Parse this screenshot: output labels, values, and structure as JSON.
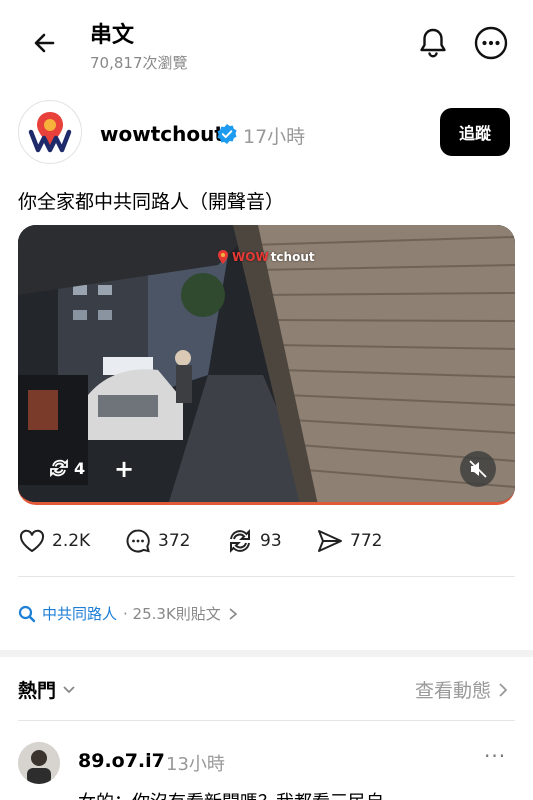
{
  "header": {
    "title": "串文",
    "views": "70,817次瀏覽"
  },
  "post": {
    "username": "wowtchout",
    "time": "17小時",
    "follow_label": "追蹤",
    "text": "你全家都中共同路人（開聲音）",
    "media": {
      "watermark_red": "WOW",
      "watermark_white": "tchout",
      "carousel_count": "4",
      "add_label": "+"
    },
    "stats": {
      "likes": "2.2K",
      "replies": "372",
      "reposts": "93",
      "shares": "772"
    }
  },
  "topic": {
    "name": "中共同路人",
    "meta": "· 25.3K則貼文"
  },
  "sort": {
    "label": "熱門",
    "see_activity": "查看動態"
  },
  "reply": {
    "username": "89.o7.i7",
    "time": "13小時",
    "more": "···",
    "text": "女的：你沒有看新聞嗎？我都看三民自"
  },
  "colors": {
    "accent_blue": "#1d7fd6",
    "brand_red": "#e53935",
    "verified_blue": "#1d9bf0"
  }
}
